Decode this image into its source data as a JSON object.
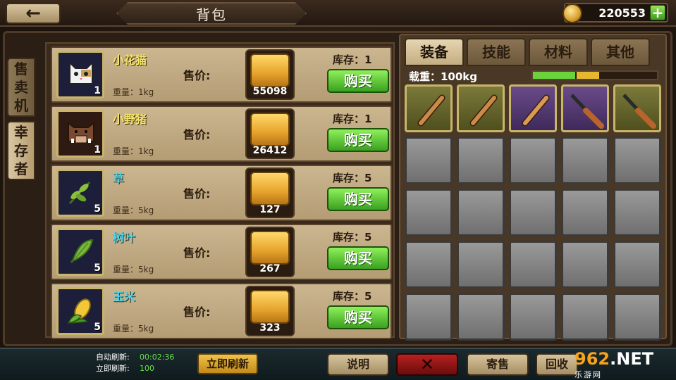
{
  "header": {
    "title": "背包",
    "coins": "220553"
  },
  "side_tabs": [
    {
      "label": "售卖机",
      "chars": [
        "售",
        "卖",
        "机"
      ]
    },
    {
      "label": "幸存者",
      "chars": [
        "幸",
        "存",
        "者"
      ]
    }
  ],
  "shop": {
    "price_label": "售价:",
    "buy_label": "购买",
    "items": [
      {
        "name": "小花猫",
        "count": "1",
        "weight": "重量：1kg",
        "price": "55098",
        "stock": "库存：1",
        "icon": "cat-icon"
      },
      {
        "name": "小野猪",
        "count": "1",
        "weight": "重量：1kg",
        "price": "26412",
        "stock": "库存：1",
        "icon": "boar-icon"
      },
      {
        "name": "草",
        "count": "5",
        "weight": "重量：5kg",
        "price": "127",
        "stock": "库存：5",
        "icon": "grass-icon"
      },
      {
        "name": "树叶",
        "count": "5",
        "weight": "重量：5kg",
        "price": "267",
        "stock": "库存：5",
        "icon": "leaf-icon"
      },
      {
        "name": "玉米",
        "count": "5",
        "weight": "重量：5kg",
        "price": "323",
        "stock": "库存：5",
        "icon": "corn-icon"
      }
    ]
  },
  "inventory": {
    "tabs": [
      "装备",
      "技能",
      "材料",
      "其他"
    ],
    "load_label": "载重：100kg",
    "load_fraction_green": 0.34,
    "load_fraction_yellow": 0.18,
    "slots": [
      "bat-icon",
      "bat-icon",
      "bat-icon",
      "shotgun-icon",
      "shotgun-icon"
    ]
  },
  "footer": {
    "auto_refresh_label": "自动刷新:",
    "auto_refresh_value": "00:02:36",
    "instant_refresh_label": "立即刷新:",
    "instant_refresh_value": "100",
    "refresh_button": "立即刷新",
    "info_button": "说明",
    "close_symbol": "✕",
    "consign_button": "寄售",
    "recycle_button": "回收"
  },
  "watermark": {
    "logo_num": "962",
    "logo_ext": ".NET",
    "sub": "乐游网"
  }
}
